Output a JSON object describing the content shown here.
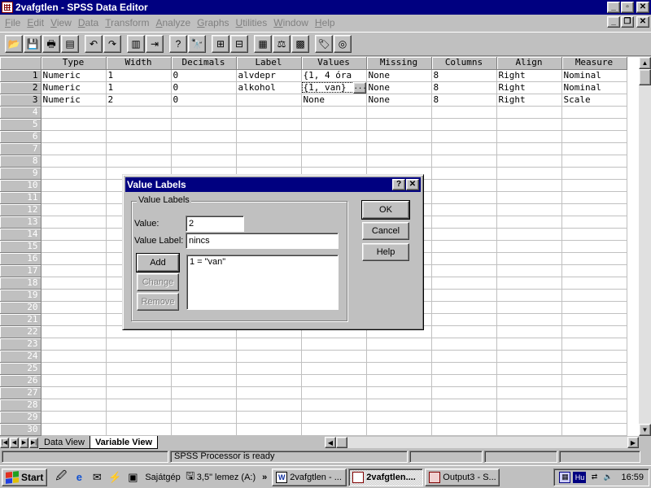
{
  "window": {
    "title": "2vafgtlen - SPSS Data Editor",
    "controls": [
      "minimize",
      "maximize",
      "close"
    ]
  },
  "menu": [
    "File",
    "Edit",
    "View",
    "Data",
    "Transform",
    "Analyze",
    "Graphs",
    "Utilities",
    "Window",
    "Help"
  ],
  "toolbar": {
    "buttons": [
      {
        "name": "open-icon",
        "glyph": "📂"
      },
      {
        "name": "save-icon",
        "glyph": "💾"
      },
      {
        "name": "print-icon",
        "glyph": "🖶"
      },
      {
        "name": "dialog-recall-icon",
        "glyph": "▤"
      },
      {
        "name": "undo-icon",
        "glyph": "↶"
      },
      {
        "name": "redo-icon",
        "glyph": "↷"
      },
      {
        "name": "goto-chart-icon",
        "glyph": "▥"
      },
      {
        "name": "goto-case-icon",
        "glyph": "⇥"
      },
      {
        "name": "variables-icon",
        "glyph": "?"
      },
      {
        "name": "find-icon",
        "glyph": "🔭"
      },
      {
        "name": "insert-case-icon",
        "glyph": "⊞"
      },
      {
        "name": "insert-variable-icon",
        "glyph": "⊟"
      },
      {
        "name": "split-file-icon",
        "glyph": "▦"
      },
      {
        "name": "weight-cases-icon",
        "glyph": "⚖"
      },
      {
        "name": "select-cases-icon",
        "glyph": "▩"
      },
      {
        "name": "value-labels-icon",
        "glyph": "🏷"
      },
      {
        "name": "use-sets-icon",
        "glyph": "◎"
      }
    ]
  },
  "grid": {
    "columns": [
      "Type",
      "Width",
      "Decimals",
      "Label",
      "Values",
      "Missing",
      "Columns",
      "Align",
      "Measure"
    ],
    "rows": [
      [
        "Numeric",
        "1",
        "0",
        "alvdepr",
        "{1, 4 óra",
        "None",
        "8",
        "Right",
        "Nominal"
      ],
      [
        "Numeric",
        "1",
        "0",
        "alkohol",
        "{1, van}",
        "None",
        "8",
        "Right",
        "Nominal"
      ],
      [
        "Numeric",
        "2",
        "0",
        "",
        "None",
        "None",
        "8",
        "Right",
        "Scale"
      ]
    ],
    "row_numbers": [
      "1",
      "2",
      "3",
      "4",
      "5",
      "6",
      "7",
      "8",
      "9",
      "10",
      "11",
      "12",
      "13",
      "14",
      "15",
      "16",
      "17",
      "18",
      "19",
      "20",
      "21",
      "22",
      "23",
      "24",
      "25",
      "26",
      "27",
      "28",
      "29",
      "30"
    ]
  },
  "tabs": {
    "data_view": "Data View",
    "variable_view": "Variable View"
  },
  "status": {
    "processor": "SPSS Processor  is ready"
  },
  "dialog": {
    "title": "Value Labels",
    "group_label": "Value Labels",
    "value_label": "Value:",
    "value": "2",
    "value_label_label": "Value Label:",
    "value_label_value": "nincs",
    "buttons": {
      "ok": "OK",
      "cancel": "Cancel",
      "help": "Help",
      "add": "Add",
      "change": "Change",
      "remove": "Remove"
    },
    "list": [
      "1 = \"van\""
    ]
  },
  "taskbar": {
    "start": "Start",
    "address_items": [
      "Sajátgép",
      "3,5\" lemez (A:)"
    ],
    "tasks": [
      {
        "label": "2vafgtlen - ...",
        "active": false
      },
      {
        "label": "2vafgtlen....",
        "active": true
      },
      {
        "label": "Output3 - S...",
        "active": false
      }
    ],
    "tray": {
      "lang": "Hu",
      "clock": "16:59"
    }
  }
}
